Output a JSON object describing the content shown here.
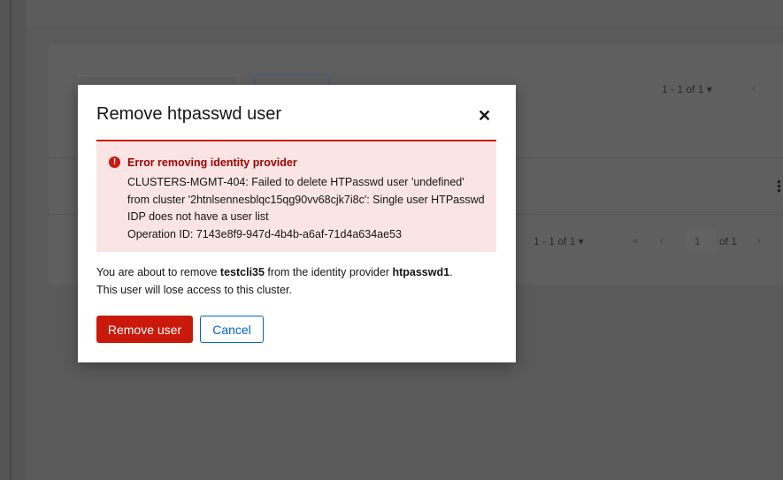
{
  "background": {
    "pagination_top": "1 - 1 of 1",
    "pagination_bottom": "1 - 1 of 1",
    "page_input": "1",
    "page_of": "of 1"
  },
  "modal": {
    "title": "Remove htpasswd user",
    "close_icon": "close-icon",
    "alert": {
      "title": "Error removing identity provider",
      "lines": [
        "CLUSTERS-MGMT-404: Failed to delete HTPasswd user 'undefined'",
        "from cluster '2htnlsennesblqc15qg90vv68cjk7i8c': Single user HTPasswd",
        "IDP does not have a user list",
        "Operation ID: 7143e8f9-947d-4b4b-a6af-71d4a634ae53"
      ]
    },
    "body": {
      "prefix": "You are about to remove ",
      "user": "testcli35",
      "middle": " from the identity provider ",
      "provider": "htpasswd1",
      "suffix": ".",
      "line2": "This user will lose access to this cluster."
    },
    "confirm_label": "Remove user",
    "cancel_label": "Cancel"
  },
  "colors": {
    "danger": "#c9190b",
    "link": "#0066cc",
    "alert_bg": "#fae5e4"
  }
}
